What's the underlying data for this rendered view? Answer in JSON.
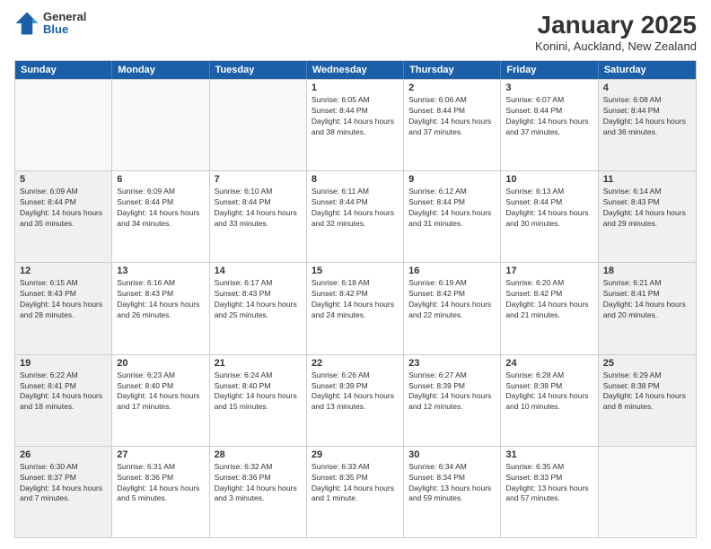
{
  "logo": {
    "general": "General",
    "blue": "Blue"
  },
  "header": {
    "month": "January 2025",
    "location": "Konini, Auckland, New Zealand"
  },
  "days_of_week": [
    "Sunday",
    "Monday",
    "Tuesday",
    "Wednesday",
    "Thursday",
    "Friday",
    "Saturday"
  ],
  "rows": [
    {
      "cells": [
        {
          "day": "",
          "empty": true
        },
        {
          "day": "",
          "empty": true
        },
        {
          "day": "",
          "empty": true
        },
        {
          "day": "1",
          "sunrise": "6:05 AM",
          "sunset": "8:44 PM",
          "daylight": "14 hours and 38 minutes."
        },
        {
          "day": "2",
          "sunrise": "6:06 AM",
          "sunset": "8:44 PM",
          "daylight": "14 hours and 37 minutes."
        },
        {
          "day": "3",
          "sunrise": "6:07 AM",
          "sunset": "8:44 PM",
          "daylight": "14 hours and 37 minutes."
        },
        {
          "day": "4",
          "sunrise": "6:08 AM",
          "sunset": "8:44 PM",
          "daylight": "14 hours and 36 minutes.",
          "shaded": true
        }
      ]
    },
    {
      "cells": [
        {
          "day": "5",
          "sunrise": "6:09 AM",
          "sunset": "8:44 PM",
          "daylight": "14 hours and 35 minutes.",
          "shaded": true
        },
        {
          "day": "6",
          "sunrise": "6:09 AM",
          "sunset": "8:44 PM",
          "daylight": "14 hours and 34 minutes."
        },
        {
          "day": "7",
          "sunrise": "6:10 AM",
          "sunset": "8:44 PM",
          "daylight": "14 hours and 33 minutes."
        },
        {
          "day": "8",
          "sunrise": "6:11 AM",
          "sunset": "8:44 PM",
          "daylight": "14 hours and 32 minutes."
        },
        {
          "day": "9",
          "sunrise": "6:12 AM",
          "sunset": "8:44 PM",
          "daylight": "14 hours and 31 minutes."
        },
        {
          "day": "10",
          "sunrise": "6:13 AM",
          "sunset": "8:44 PM",
          "daylight": "14 hours and 30 minutes."
        },
        {
          "day": "11",
          "sunrise": "6:14 AM",
          "sunset": "8:43 PM",
          "daylight": "14 hours and 29 minutes.",
          "shaded": true
        }
      ]
    },
    {
      "cells": [
        {
          "day": "12",
          "sunrise": "6:15 AM",
          "sunset": "8:43 PM",
          "daylight": "14 hours and 28 minutes.",
          "shaded": true
        },
        {
          "day": "13",
          "sunrise": "6:16 AM",
          "sunset": "8:43 PM",
          "daylight": "14 hours and 26 minutes."
        },
        {
          "day": "14",
          "sunrise": "6:17 AM",
          "sunset": "8:43 PM",
          "daylight": "14 hours and 25 minutes."
        },
        {
          "day": "15",
          "sunrise": "6:18 AM",
          "sunset": "8:42 PM",
          "daylight": "14 hours and 24 minutes."
        },
        {
          "day": "16",
          "sunrise": "6:19 AM",
          "sunset": "8:42 PM",
          "daylight": "14 hours and 22 minutes."
        },
        {
          "day": "17",
          "sunrise": "6:20 AM",
          "sunset": "8:42 PM",
          "daylight": "14 hours and 21 minutes."
        },
        {
          "day": "18",
          "sunrise": "6:21 AM",
          "sunset": "8:41 PM",
          "daylight": "14 hours and 20 minutes.",
          "shaded": true
        }
      ]
    },
    {
      "cells": [
        {
          "day": "19",
          "sunrise": "6:22 AM",
          "sunset": "8:41 PM",
          "daylight": "14 hours and 18 minutes.",
          "shaded": true
        },
        {
          "day": "20",
          "sunrise": "6:23 AM",
          "sunset": "8:40 PM",
          "daylight": "14 hours and 17 minutes."
        },
        {
          "day": "21",
          "sunrise": "6:24 AM",
          "sunset": "8:40 PM",
          "daylight": "14 hours and 15 minutes."
        },
        {
          "day": "22",
          "sunrise": "6:26 AM",
          "sunset": "8:39 PM",
          "daylight": "14 hours and 13 minutes."
        },
        {
          "day": "23",
          "sunrise": "6:27 AM",
          "sunset": "8:39 PM",
          "daylight": "14 hours and 12 minutes."
        },
        {
          "day": "24",
          "sunrise": "6:28 AM",
          "sunset": "8:38 PM",
          "daylight": "14 hours and 10 minutes."
        },
        {
          "day": "25",
          "sunrise": "6:29 AM",
          "sunset": "8:38 PM",
          "daylight": "14 hours and 8 minutes.",
          "shaded": true
        }
      ]
    },
    {
      "cells": [
        {
          "day": "26",
          "sunrise": "6:30 AM",
          "sunset": "8:37 PM",
          "daylight": "14 hours and 7 minutes.",
          "shaded": true
        },
        {
          "day": "27",
          "sunrise": "6:31 AM",
          "sunset": "8:36 PM",
          "daylight": "14 hours and 5 minutes."
        },
        {
          "day": "28",
          "sunrise": "6:32 AM",
          "sunset": "8:36 PM",
          "daylight": "14 hours and 3 minutes."
        },
        {
          "day": "29",
          "sunrise": "6:33 AM",
          "sunset": "8:35 PM",
          "daylight": "14 hours and 1 minute."
        },
        {
          "day": "30",
          "sunrise": "6:34 AM",
          "sunset": "8:34 PM",
          "daylight": "13 hours and 59 minutes."
        },
        {
          "day": "31",
          "sunrise": "6:35 AM",
          "sunset": "8:33 PM",
          "daylight": "13 hours and 57 minutes."
        },
        {
          "day": "",
          "empty": true,
          "shaded": true
        }
      ]
    }
  ],
  "daylight_label": "Daylight:"
}
